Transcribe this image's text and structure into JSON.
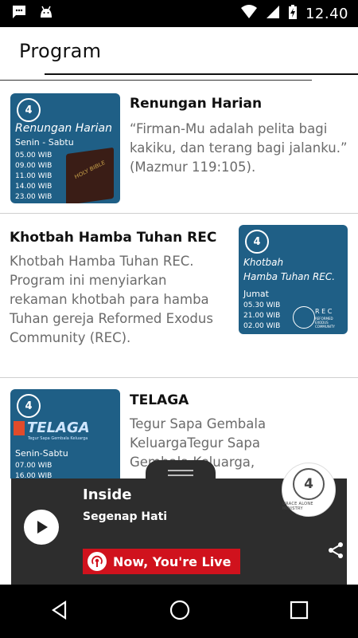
{
  "status_bar": {
    "time": "12.40",
    "left_icons": [
      "message-icon",
      "android-icon"
    ],
    "right_icons": [
      "wifi-icon",
      "signal-icon",
      "battery-charging-icon"
    ]
  },
  "header": {
    "title": "Program"
  },
  "programs": [
    {
      "title": "Renungan Harian",
      "description": "“Firman-Mu adalah pelita bagi kakiku, dan terang bagi jalanku.” (Mazmur 119:105).",
      "thumb": {
        "title": "Renungan Harian",
        "days": "Senin - Sabtu",
        "times": [
          "05.00 WIB",
          "09.00 WIB",
          "11.00 WIB",
          "14.00 WIB",
          "23.00 WIB"
        ],
        "image_label": "HOLY BIBLE"
      }
    },
    {
      "title": "Khotbah Hamba Tuhan REC",
      "description": "Khotbah Hamba Tuhan REC.  Program ini menyiarkan rekaman khotbah para hamba Tuhan gereja Reformed Exodus Community (REC).",
      "thumb": {
        "title_line1": "Khotbah",
        "title_line2": "Hamba Tuhan REC.",
        "days": "Jumat",
        "times": [
          "05.30 WIB",
          "21.00 WIB",
          "02.00 WIB"
        ],
        "rec_label": "R E C",
        "rec_sub": "REFORMED EXODUS COMMUNITY"
      }
    },
    {
      "title": "TELAGA",
      "description": "Tegur Sapa Gembala KeluargaTegur Sapa Gembala Keluarga,",
      "thumb": {
        "brand": "TELAGA",
        "tagline": "Tegur Sapa Gembala Keluarga",
        "days": "Senin-Sabtu",
        "times": [
          "07.00 WIB",
          "16.00 WIB"
        ]
      }
    }
  ],
  "player": {
    "track_title": "Inside",
    "track_artist": "Segenap Hati",
    "live_label": "Now, You're Live",
    "station_caption": "GRACE ALONE MINISTRY"
  },
  "colors": {
    "thumb_blue": "#1f5f86",
    "player_bg": "#2d2d2d",
    "live_red": "#d0121d"
  }
}
